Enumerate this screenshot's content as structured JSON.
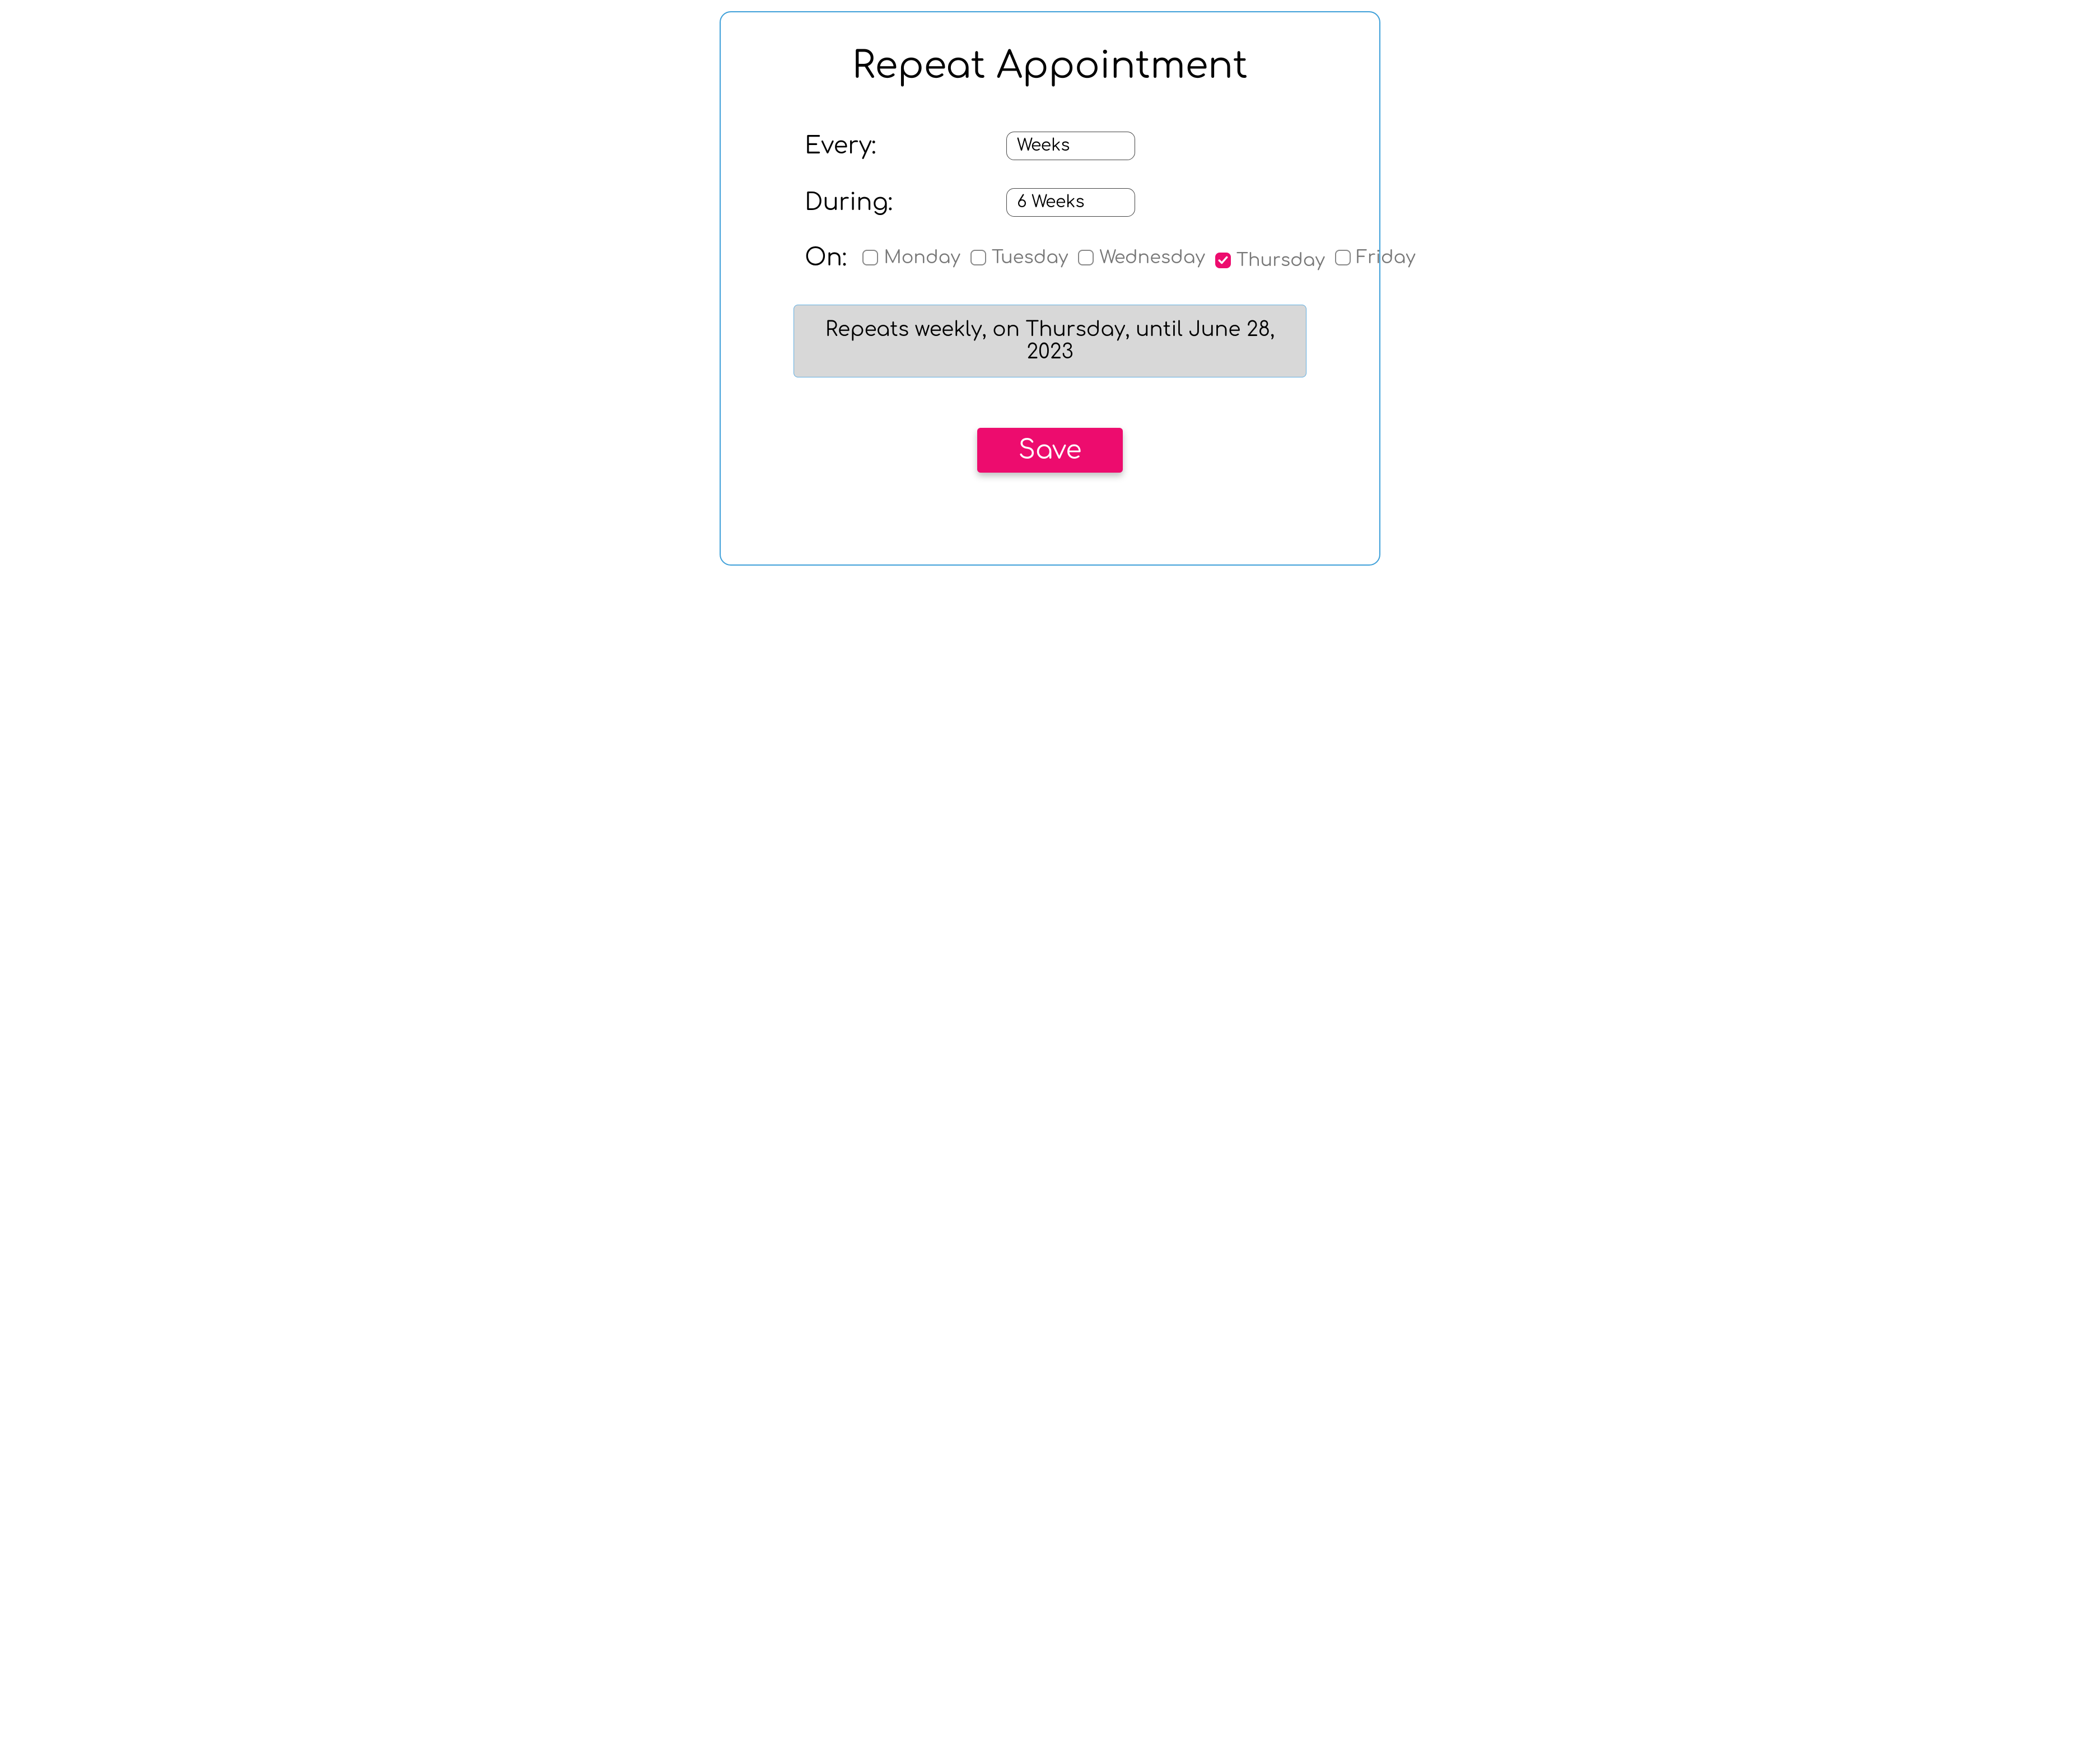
{
  "dialog": {
    "title": "Repeat Appointment",
    "every": {
      "label": "Every:",
      "value": "Weeks"
    },
    "during": {
      "label": "During:",
      "value": "6 Weeks"
    },
    "on": {
      "label": "On:",
      "days": [
        {
          "label": "Monday",
          "checked": false
        },
        {
          "label": "Tuesday",
          "checked": false
        },
        {
          "label": "Wednesday",
          "checked": false
        },
        {
          "label": "Thursday",
          "checked": true
        },
        {
          "label": "Friday",
          "checked": false
        }
      ]
    },
    "summary": "Repeats weekly, on Thursday, until June 28, 2023",
    "save_label": "Save"
  },
  "colors": {
    "accent": "#ed0c6e",
    "border": "#3fa0d9",
    "summary_bg": "#d8d8d8"
  }
}
